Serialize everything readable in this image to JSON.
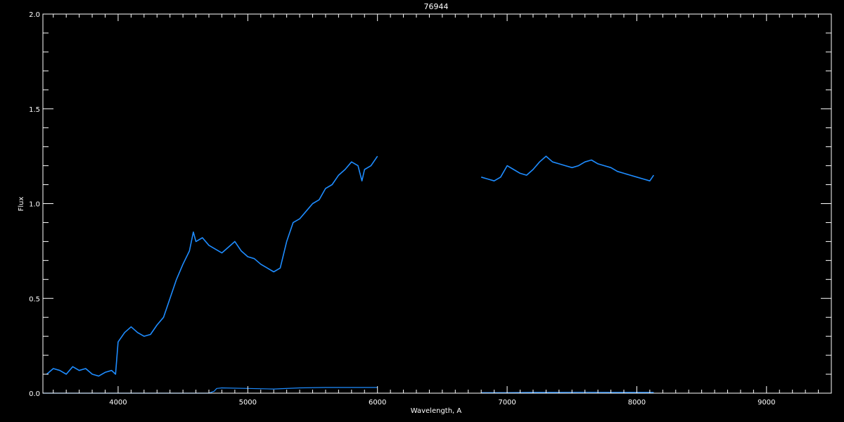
{
  "chart_data": {
    "type": "line",
    "title": "76944",
    "xlabel": "Wavelength, A",
    "ylabel": "Flux",
    "xlim": [
      3420,
      9500
    ],
    "ylim": [
      0.0,
      2.0
    ],
    "x_major_ticks": [
      4000,
      5000,
      6000,
      7000,
      8000,
      9000
    ],
    "x_minor_step": 100,
    "y_major_ticks": [
      0.0,
      0.5,
      1.0,
      1.5,
      2.0
    ],
    "y_minor_step": 0.1,
    "x_tick_labels": [
      "4000",
      "5000",
      "6000",
      "7000",
      "8000",
      "9000"
    ],
    "y_tick_labels": [
      "0.0",
      "0.5",
      "1.0",
      "1.5",
      "2.0"
    ],
    "grid": false,
    "series_color": "#1e8cff",
    "background": "#000000",
    "foreground": "#ffffff",
    "series": [
      {
        "role": "spectrum",
        "segments": [
          {
            "x": [
              3450,
              3500,
              3550,
              3600,
              3650,
              3700,
              3750,
              3800,
              3850,
              3900,
              3950,
              3980,
              4000,
              4050,
              4100,
              4150,
              4200,
              4250,
              4300,
              4350,
              4400,
              4450,
              4500,
              4550,
              4580,
              4600,
              4650,
              4700,
              4750,
              4800,
              4850,
              4900,
              4950,
              5000,
              5050,
              5100,
              5150,
              5200,
              5250,
              5300,
              5350,
              5400,
              5450,
              5500,
              5550,
              5600,
              5650,
              5700,
              5750,
              5800,
              5850,
              5880,
              5900,
              5950,
              6000
            ],
            "y": [
              0.1,
              0.13,
              0.12,
              0.1,
              0.14,
              0.12,
              0.13,
              0.1,
              0.09,
              0.11,
              0.12,
              0.1,
              0.27,
              0.32,
              0.35,
              0.32,
              0.3,
              0.31,
              0.36,
              0.4,
              0.5,
              0.6,
              0.68,
              0.75,
              0.85,
              0.8,
              0.82,
              0.78,
              0.76,
              0.74,
              0.77,
              0.8,
              0.75,
              0.72,
              0.71,
              0.68,
              0.66,
              0.64,
              0.66,
              0.8,
              0.9,
              0.92,
              0.96,
              1.0,
              1.02,
              1.08,
              1.1,
              1.15,
              1.18,
              1.22,
              1.2,
              1.12,
              1.18,
              1.2,
              1.25
            ]
          },
          {
            "x": [
              6800,
              6850,
              6900,
              6950,
              7000,
              7050,
              7100,
              7150,
              7200,
              7250,
              7300,
              7350,
              7400,
              7450,
              7500,
              7550,
              7600,
              7650,
              7700,
              7750,
              7800,
              7850,
              7900,
              7950,
              8000,
              8050,
              8100,
              8130
            ],
            "y": [
              1.14,
              1.13,
              1.12,
              1.14,
              1.2,
              1.18,
              1.16,
              1.15,
              1.18,
              1.22,
              1.25,
              1.22,
              1.21,
              1.2,
              1.19,
              1.2,
              1.22,
              1.23,
              1.21,
              1.2,
              1.19,
              1.17,
              1.16,
              1.15,
              1.14,
              1.13,
              1.12,
              1.15
            ]
          }
        ]
      },
      {
        "role": "error",
        "segments": [
          {
            "x": [
              3420,
              4700,
              4740,
              4760,
              4800,
              5000,
              5200,
              5400,
              5600,
              5800,
              6000
            ],
            "y": [
              0.0,
              0.0,
              0.01,
              0.025,
              0.028,
              0.025,
              0.022,
              0.028,
              0.03,
              0.03,
              0.03
            ]
          },
          {
            "x": [
              6800,
              7000,
              7200,
              7400,
              7600,
              7800,
              8000,
              8130
            ],
            "y": [
              0.003,
              0.003,
              0.004,
              0.004,
              0.005,
              0.004,
              0.004,
              0.004
            ]
          }
        ]
      }
    ]
  }
}
